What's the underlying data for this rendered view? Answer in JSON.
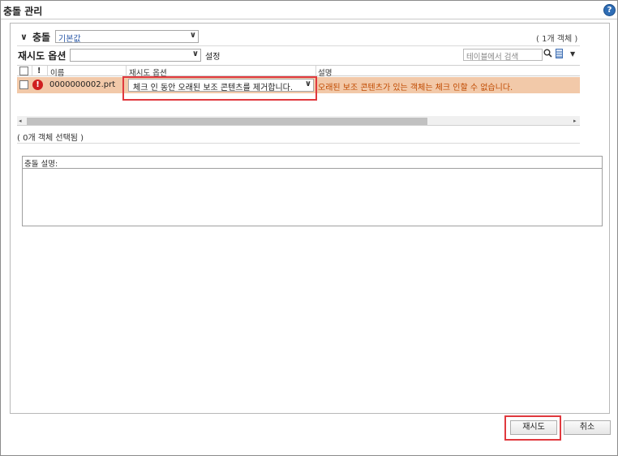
{
  "window": {
    "title": "충돌 관리"
  },
  "conflict_section": {
    "title": "충돌",
    "filter_value": "기본값",
    "object_count": "( 1개 객체 )"
  },
  "retry_options": {
    "title": "재시도 옵션",
    "combo_value": "",
    "settings_label": "설정",
    "search_placeholder": "테이블에서 검색"
  },
  "table": {
    "columns": [
      "!",
      "이름",
      "재시도 옵션",
      "설명"
    ],
    "rows": [
      {
        "name": "0000000002.prt",
        "retry_option": "체크 인 동안 오래된 보조 콘텐츠를 제거합니다.",
        "description": "오래된 보조 콘텐츠가 있는 객체는 체크 인할 수 없습니다."
      }
    ]
  },
  "selection_status": "( 0개 객체 선택됨 )",
  "conflict_description": {
    "label": "충돌 설명:"
  },
  "buttons": {
    "retry": "재시도",
    "cancel": "취소"
  },
  "icons": {
    "help": "help-icon",
    "error": "error-icon",
    "search": "search-icon",
    "table_options": "table-options-icon"
  },
  "colors": {
    "row_highlight": "#f2c9a9",
    "annotation_red": "#e0393e",
    "error_red": "#cf1f1f",
    "desc_text": "#c04a00"
  }
}
